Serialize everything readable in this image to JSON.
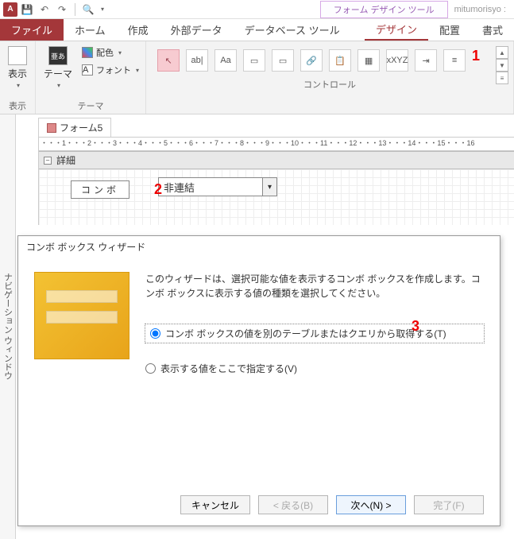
{
  "titlebar": {
    "app": "A",
    "tool_tab": "フォーム デザイン ツール",
    "db_name": "mitumorisyo :"
  },
  "ribbon": {
    "file": "ファイル",
    "tabs": [
      "ホーム",
      "作成",
      "外部データ",
      "データベース ツール"
    ],
    "context_tabs": [
      "デザイン",
      "配置",
      "書式"
    ],
    "active_tab": "デザイン",
    "group_view": {
      "label_display": "表示",
      "btn_display": "表示"
    },
    "group_theme": {
      "label": "テーマ",
      "btn_theme": "テーマ",
      "btn_colors": "配色",
      "btn_fonts": "フォント"
    },
    "group_controls": {
      "label": "コントロール",
      "items": [
        "↖",
        "ab|",
        "Aa",
        "▭",
        "▭",
        "🔗",
        "📋",
        "▦",
        "xXYZ",
        "⇥",
        "≡"
      ]
    }
  },
  "form": {
    "tab_name": "フォーム5",
    "section_detail": "詳細",
    "label_text": "コンボ",
    "combo_value": "非連結",
    "ruler": "・・・1・・・2・・・3・・・4・・・5・・・6・・・7・・・8・・・9・・・10・・・11・・・12・・・13・・・14・・・15・・・16"
  },
  "nav_pane": {
    "label": "ナビゲーション ウィンドウ"
  },
  "wizard": {
    "title": "コンボ ボックス ウィザード",
    "desc": "このウィザードは、選択可能な値を表示するコンボ ボックスを作成します。コンボ ボックスに表示する値の種類を選択してください。",
    "opt1": "コンボ ボックスの値を別のテーブルまたはクエリから取得する(T)",
    "opt2": "表示する値をここで指定する(V)",
    "btn_cancel": "キャンセル",
    "btn_back": "< 戻る(B)",
    "btn_next": "次へ(N) >",
    "btn_finish": "完了(F)"
  },
  "annotations": {
    "a1": "1",
    "a2": "2",
    "a3": "3"
  }
}
